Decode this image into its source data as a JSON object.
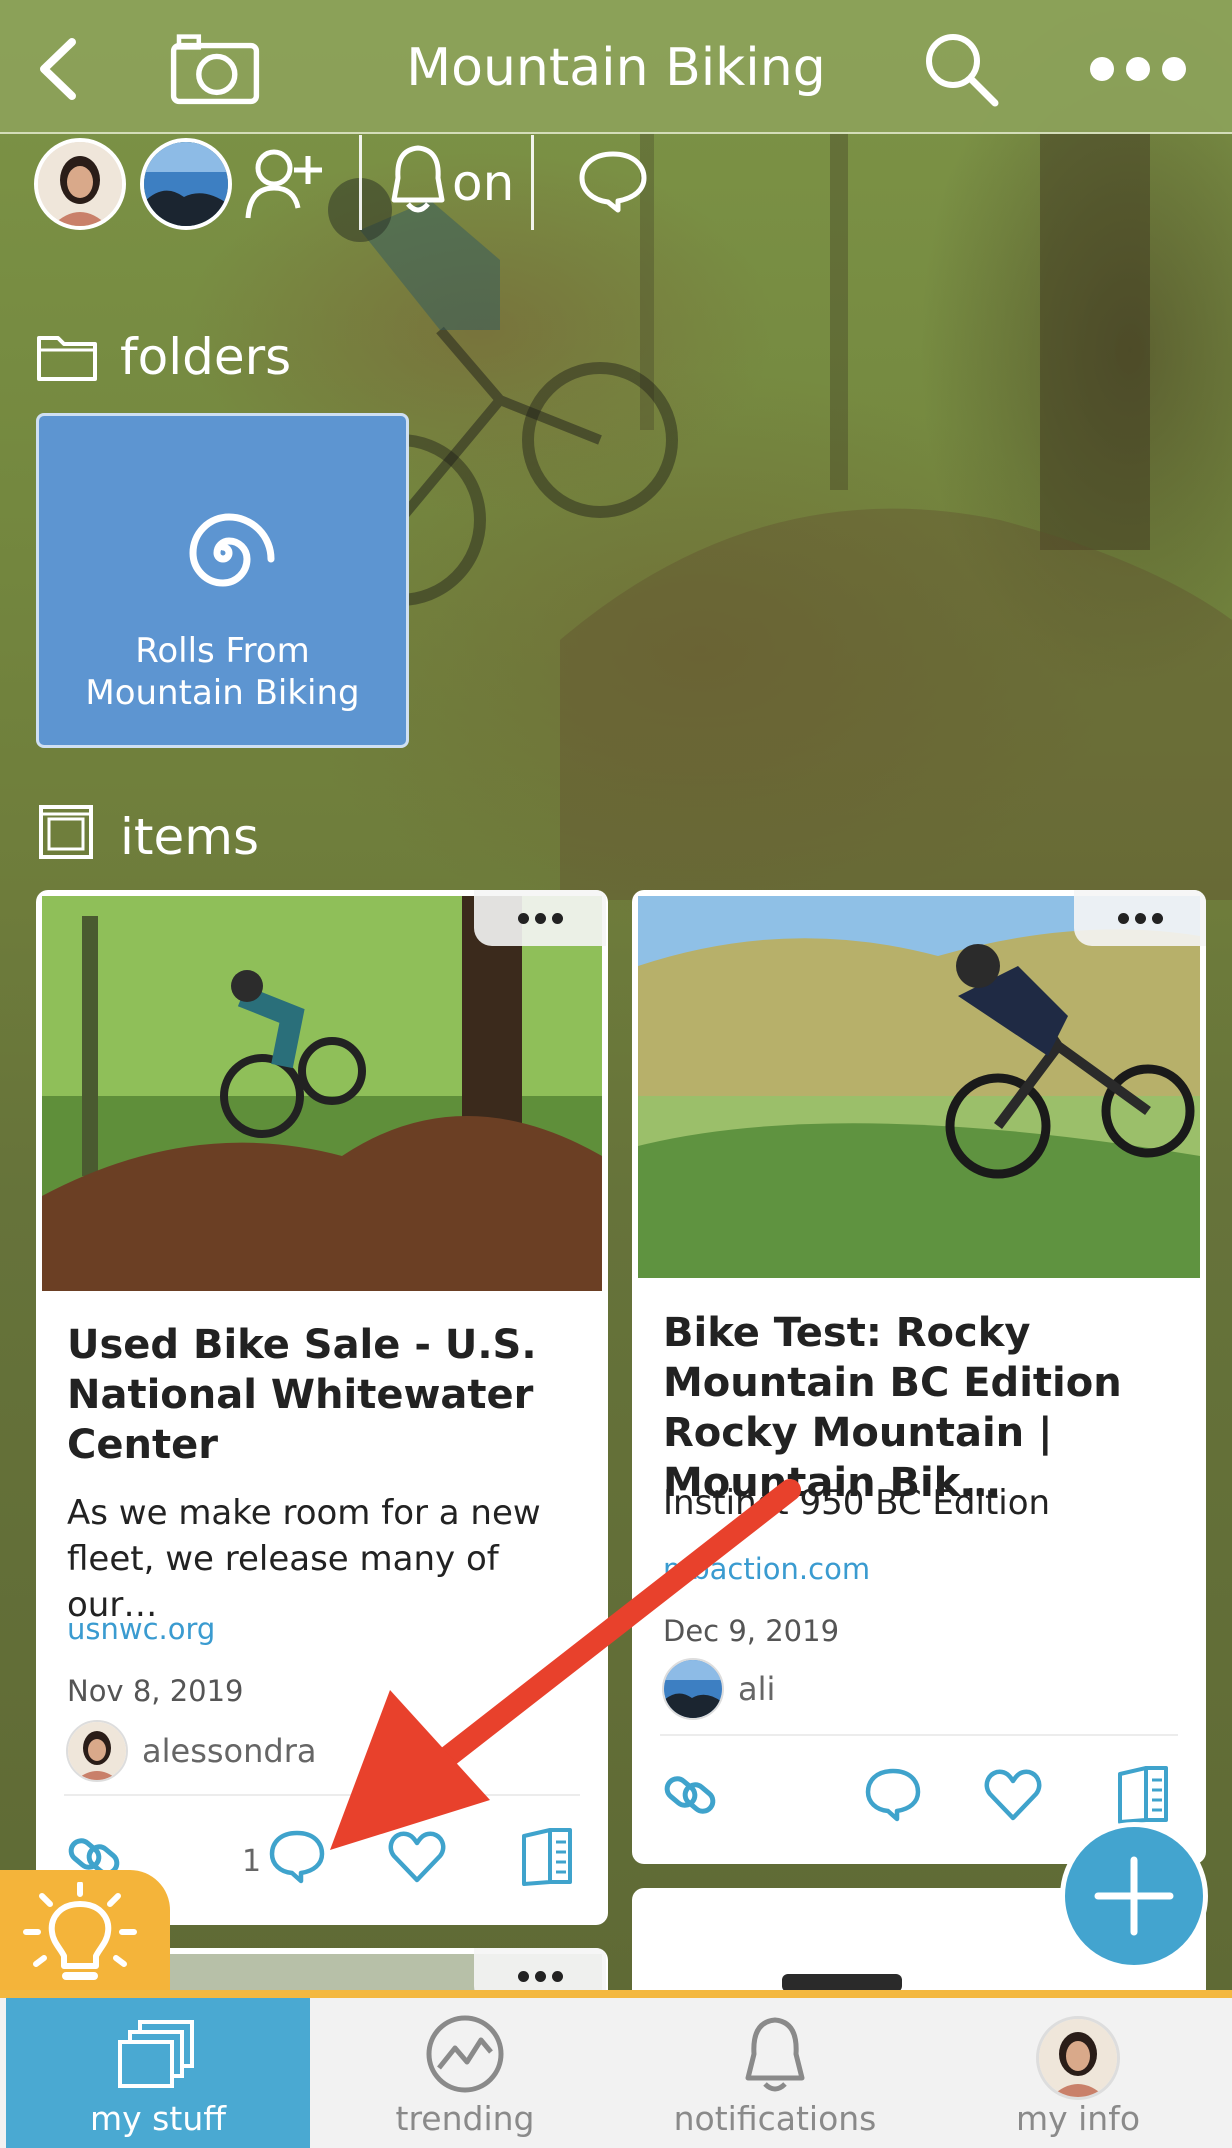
{
  "header": {
    "title": "Mountain Biking"
  },
  "members": {
    "notify_label": "on"
  },
  "sections": {
    "folders_label": "folders",
    "items_label": "items"
  },
  "folders": [
    {
      "title": "Rolls From Mountain Biking"
    }
  ],
  "items": [
    {
      "title": "Used Bike Sale - U.S. National Whitewater Center",
      "description": "As we make room for a new fleet, we release many of our…",
      "source": "usnwc.org",
      "date": "Nov 8, 2019",
      "user": "alessondra",
      "comment_count": "1"
    },
    {
      "title": "Bike Test: Rocky Mountain BC Edition Rocky Mountain | Mountain Bik…",
      "description": "Instinct 950 BC Edition",
      "source": "mbaction.com",
      "date": "Dec 9, 2019",
      "user": "ali"
    }
  ],
  "bottom_nav": [
    {
      "label": "my stuff",
      "active": true
    },
    {
      "label": "trending"
    },
    {
      "label": "notifications"
    },
    {
      "label": "my info"
    }
  ],
  "colors": {
    "header": "#8ca25a",
    "folder_tile": "#5d95d1",
    "accent_blue": "#43a4cf",
    "link": "#3a9bd0",
    "tip_yellow": "#f4b43a",
    "annotation_arrow": "#e8412c"
  },
  "icons": {
    "back": "back-arrow-icon",
    "camera": "camera-icon",
    "search": "search-icon",
    "more": "more-dots-icon",
    "add_member": "add-person-icon",
    "bell": "bell-icon",
    "chat": "chat-bubble-icon",
    "folder": "folder-icon",
    "items": "items-icon",
    "spiral": "spiral-icon",
    "link": "link-icon",
    "heart": "heart-icon",
    "book": "book-icon",
    "plus": "plus-icon",
    "lightbulb": "lightbulb-icon",
    "trending": "trending-icon"
  }
}
